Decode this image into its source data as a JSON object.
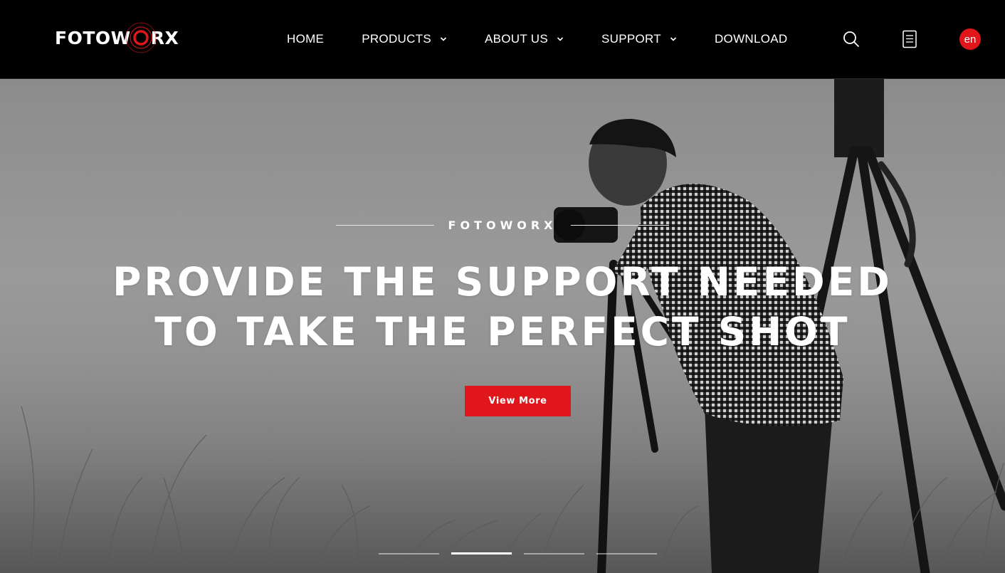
{
  "brand": {
    "logo_before": "FOTOW",
    "logo_o": "O",
    "logo_after": "RX",
    "accent_color": "#e0161b"
  },
  "nav": {
    "items": [
      {
        "label": "HOME",
        "dropdown": false
      },
      {
        "label": "PRODUCTS",
        "dropdown": true
      },
      {
        "label": "ABOUT US",
        "dropdown": true
      },
      {
        "label": "SUPPORT",
        "dropdown": true
      },
      {
        "label": "DOWNLOAD",
        "dropdown": false
      }
    ]
  },
  "header_icons": {
    "search": "search-icon",
    "document": "document-icon",
    "language": "en"
  },
  "hero": {
    "eyebrow": "FOTOWORX",
    "headline_line1": "PROVIDE THE SUPPORT NEEDED",
    "headline_line2": "TO TAKE THE PERFECT SHOT",
    "cta_label": "View More",
    "slides_total": 4,
    "active_slide": 2
  }
}
